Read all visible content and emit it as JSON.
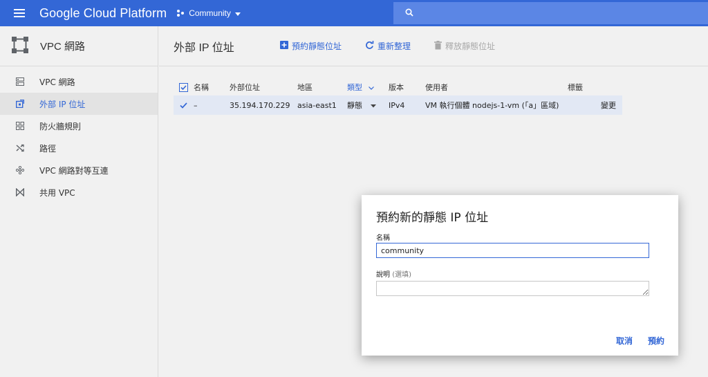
{
  "topbar": {
    "brand": "Google Cloud Platform",
    "project": "Community",
    "menu_icon": "hamburger-menu-icon",
    "search_icon": "search-icon",
    "accent": "#3367d6"
  },
  "sidebar": {
    "title": "VPC 網路",
    "items": [
      {
        "label": "VPC 網路",
        "icon": "vpc-network-icon"
      },
      {
        "label": "外部 IP 位址",
        "icon": "external-ip-icon"
      },
      {
        "label": "防火牆規則",
        "icon": "firewall-icon"
      },
      {
        "label": "路徑",
        "icon": "routes-icon"
      },
      {
        "label": "VPC 網路對等互連",
        "icon": "peering-icon"
      },
      {
        "label": "共用 VPC",
        "icon": "shared-vpc-icon"
      }
    ],
    "active_index": 1
  },
  "main": {
    "title": "外部 IP 位址",
    "toolbar": {
      "reserve": "預約靜態位址",
      "refresh": "重新整理",
      "release": "釋放靜態位址"
    }
  },
  "table": {
    "headers": {
      "name": "名稱",
      "address": "外部位址",
      "region": "地區",
      "type": "類型",
      "version": "版本",
      "user": "使用者",
      "labels": "標籤"
    },
    "rows": [
      {
        "name": "–",
        "address": "35.194.170.229",
        "region": "asia-east1",
        "type": "靜態",
        "version": "IPv4",
        "user_prefix": "VM 執行個體 ",
        "user_vm": "nodejs-1-vm",
        "user_suffix": " (「a」區域)",
        "action": "變更"
      }
    ]
  },
  "dialog": {
    "title": "預約新的靜態 IP 位址",
    "name_label": "名稱",
    "name_value": "community",
    "desc_label": "說明",
    "desc_optional": "(選填)",
    "desc_value": "",
    "cancel": "取消",
    "submit": "預約"
  }
}
